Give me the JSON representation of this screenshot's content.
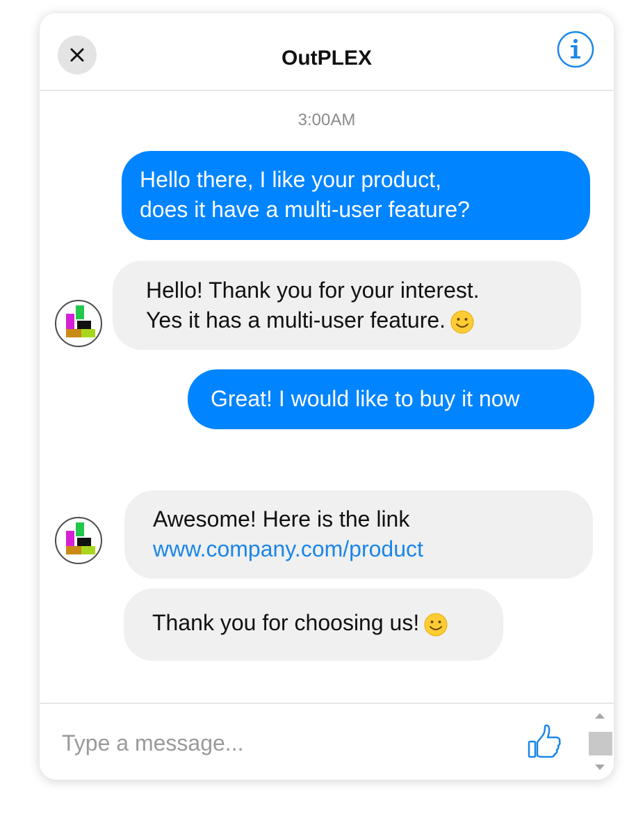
{
  "header": {
    "title": "OutPLEX",
    "close_icon": "close-icon",
    "info_icon": "info-icon"
  },
  "timestamp": "3:00AM",
  "messages": [
    {
      "direction": "outgoing",
      "lines": [
        "Hello there, I like your product,",
        "does it have a multi-user feature?"
      ]
    },
    {
      "direction": "incoming",
      "lines": [
        "Hello! Thank you for your interest.",
        "Yes it has a multi-user feature."
      ],
      "emoji": "smile-emoji-icon"
    },
    {
      "direction": "outgoing",
      "lines": [
        "Great! I would like to buy it now"
      ]
    },
    {
      "direction": "incoming",
      "lines": [
        "Awesome! Here is the link",
        "www.company.com/product"
      ]
    },
    {
      "direction": "incoming",
      "lines": [
        "Thank you for choosing us!"
      ],
      "emoji": "smile-emoji-icon"
    }
  ],
  "composer": {
    "placeholder": "Type a message...",
    "like_icon": "thumbs-up-icon"
  },
  "colors": {
    "outgoing_bubble": "#0084ff",
    "incoming_bubble": "#f0f0f0",
    "link": "#1a86e8",
    "accent": "#1a86e8"
  }
}
